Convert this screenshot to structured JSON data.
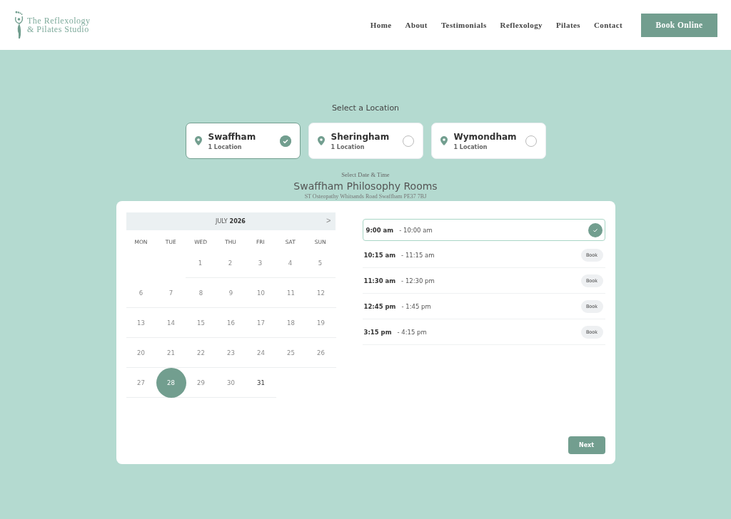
{
  "header": {
    "logo_line_1": "The Reflexology",
    "logo_line_2": "& Pilates Studio",
    "nav": [
      "Home",
      "About",
      "Testimonials",
      "Reflexology",
      "Pilates",
      "Contact"
    ],
    "cta": "Book Online"
  },
  "location_heading": "Select a Location",
  "locations": [
    {
      "name": "Swaffham",
      "sub": "1 Location",
      "selected": true
    },
    {
      "name": "Sheringham",
      "sub": "1 Location",
      "selected": false
    },
    {
      "name": "Wymondham",
      "sub": "1 Location",
      "selected": false
    }
  ],
  "date_heading": "Select Date & Time",
  "venue": "Swaffham Philosophy Rooms",
  "address": "ST Osteopathy Whitsands Road Swaffham PE37 7BJ",
  "calendar": {
    "month": "JULY",
    "year": "2026",
    "next": ">",
    "weekdays": [
      "MON",
      "TUE",
      "WED",
      "THU",
      "FRI",
      "SAT",
      "SUN"
    ],
    "weeks": [
      [
        {
          "kind": "blank"
        },
        {
          "kind": "blank"
        },
        {
          "kind": "day",
          "label": "1",
          "available": false,
          "selected": false
        },
        {
          "kind": "day",
          "label": "2",
          "available": false,
          "selected": false
        },
        {
          "kind": "day",
          "label": "3",
          "available": false,
          "selected": false
        },
        {
          "kind": "day",
          "label": "4",
          "available": false,
          "selected": false
        },
        {
          "kind": "day",
          "label": "5",
          "available": false,
          "selected": false
        }
      ],
      [
        {
          "kind": "day",
          "label": "6",
          "available": false,
          "selected": false
        },
        {
          "kind": "day",
          "label": "7",
          "available": false,
          "selected": false
        },
        {
          "kind": "day",
          "label": "8",
          "available": false,
          "selected": false
        },
        {
          "kind": "day",
          "label": "9",
          "available": false,
          "selected": false
        },
        {
          "kind": "day",
          "label": "10",
          "available": false,
          "selected": false
        },
        {
          "kind": "day",
          "label": "11",
          "available": false,
          "selected": false
        },
        {
          "kind": "day",
          "label": "12",
          "available": false,
          "selected": false
        }
      ],
      [
        {
          "kind": "day",
          "label": "13",
          "available": false,
          "selected": false
        },
        {
          "kind": "day",
          "label": "14",
          "available": false,
          "selected": false
        },
        {
          "kind": "day",
          "label": "15",
          "available": false,
          "selected": false
        },
        {
          "kind": "day",
          "label": "16",
          "available": false,
          "selected": false
        },
        {
          "kind": "day",
          "label": "17",
          "available": false,
          "selected": false
        },
        {
          "kind": "day",
          "label": "18",
          "available": false,
          "selected": false
        },
        {
          "kind": "day",
          "label": "19",
          "available": false,
          "selected": false
        }
      ],
      [
        {
          "kind": "day",
          "label": "20",
          "available": false,
          "selected": false
        },
        {
          "kind": "day",
          "label": "21",
          "available": false,
          "selected": false
        },
        {
          "kind": "day",
          "label": "22",
          "available": false,
          "selected": false
        },
        {
          "kind": "day",
          "label": "23",
          "available": false,
          "selected": false
        },
        {
          "kind": "day",
          "label": "24",
          "available": false,
          "selected": false
        },
        {
          "kind": "day",
          "label": "25",
          "available": false,
          "selected": false
        },
        {
          "kind": "day",
          "label": "26",
          "available": false,
          "selected": false
        }
      ],
      [
        {
          "kind": "day",
          "label": "27",
          "available": false,
          "selected": false
        },
        {
          "kind": "day",
          "label": "28",
          "available": true,
          "selected": true
        },
        {
          "kind": "day",
          "label": "29",
          "available": false,
          "selected": false
        },
        {
          "kind": "day",
          "label": "30",
          "available": false,
          "selected": false
        },
        {
          "kind": "day",
          "label": "31",
          "available": true,
          "selected": false
        }
      ]
    ]
  },
  "slots": [
    {
      "start": "9:00 am",
      "end": "- 10:00 am",
      "selected": true
    },
    {
      "start": "10:15 am",
      "end": "- 11:15 am",
      "selected": false,
      "action": "Book"
    },
    {
      "start": "11:30 am",
      "end": "- 12:30 pm",
      "selected": false,
      "action": "Book"
    },
    {
      "start": "12:45 pm",
      "end": "- 1:45 pm",
      "selected": false,
      "action": "Book"
    },
    {
      "start": "3:15 pm",
      "end": "- 4:15 pm",
      "selected": false,
      "action": "Book"
    }
  ],
  "next_button": "Next"
}
